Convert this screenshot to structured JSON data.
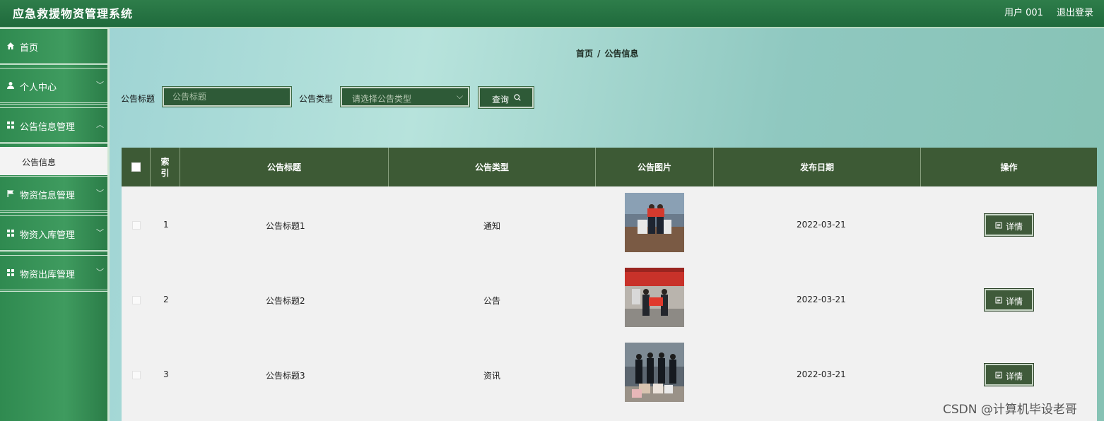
{
  "header": {
    "app_title": "应急救援物资管理系统",
    "user": "用户 001",
    "logout": "退出登录"
  },
  "sidebar": {
    "items": [
      {
        "label": "首页",
        "icon": "home-icon"
      },
      {
        "label": "个人中心",
        "icon": "person-icon"
      },
      {
        "label": "公告信息管理",
        "icon": "grid-icon"
      },
      {
        "label": "物资信息管理",
        "icon": "flag-icon"
      },
      {
        "label": "物资入库管理",
        "icon": "grid-icon"
      },
      {
        "label": "物资出库管理",
        "icon": "grid-icon"
      }
    ],
    "active_sub": "公告信息"
  },
  "breadcrumb": {
    "home": "首页",
    "sep": "/",
    "current": "公告信息"
  },
  "search": {
    "title_label": "公告标题",
    "title_placeholder": "公告标题",
    "type_label": "公告类型",
    "type_placeholder": "请选择公告类型",
    "query_label": "查询"
  },
  "table": {
    "headers": {
      "index": "索引",
      "title": "公告标题",
      "type": "公告类型",
      "image": "公告图片",
      "date": "发布日期",
      "ops": "操作"
    },
    "rows": [
      {
        "index": "1",
        "title": "公告标题1",
        "type": "通知",
        "date": "2022-03-21",
        "action": "详情"
      },
      {
        "index": "2",
        "title": "公告标题2",
        "type": "公告",
        "date": "2022-03-21",
        "action": "详情"
      },
      {
        "index": "3",
        "title": "公告标题3",
        "type": "资讯",
        "date": "2022-03-21",
        "action": "详情"
      }
    ]
  },
  "watermark": "CSDN @计算机毕设老哥",
  "colors": {
    "topbar": "#1f6a3c",
    "sidebar": "#2f8a50",
    "table_header": "#3d5a35",
    "button": "#2e5a37"
  }
}
